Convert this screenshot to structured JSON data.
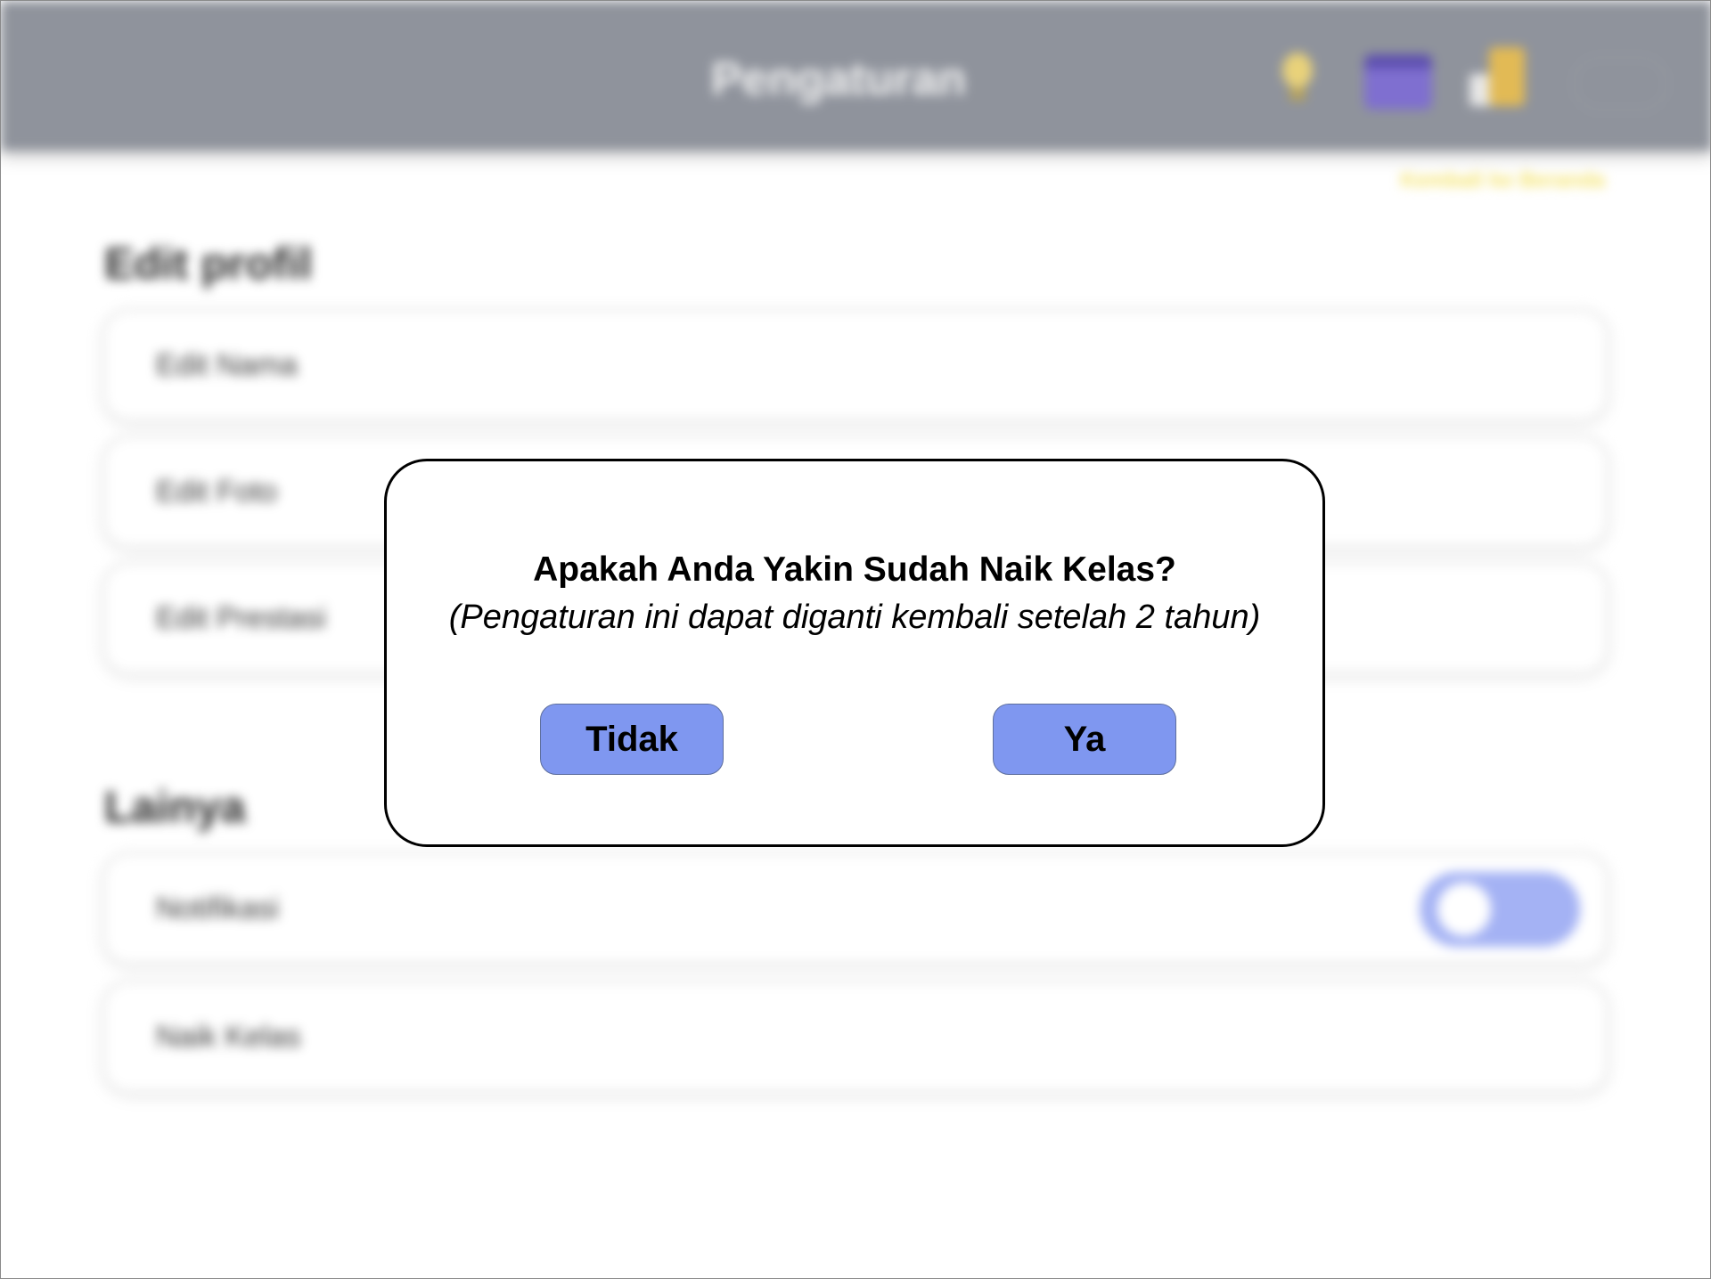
{
  "header": {
    "title": "Pengaturan",
    "icons": [
      "lightbulb-icon",
      "calendar-icon",
      "badge-icon",
      "cloud-icon"
    ]
  },
  "header_link": "Kembali ke Beranda",
  "profile_section": {
    "title": "Edit profil",
    "items": [
      {
        "label": "Edit Nama"
      },
      {
        "label": "Edit Foto"
      },
      {
        "label": "Edit Prestasi"
      }
    ]
  },
  "other_section": {
    "title": "Lainya",
    "items": [
      {
        "label": "Notifikasi",
        "toggle_on": true
      },
      {
        "label": "Naik Kelas"
      }
    ]
  },
  "dialog": {
    "title": "Apakah Anda Yakin Sudah Naik Kelas?",
    "subtitle": "(Pengaturan ini dapat diganti kembali setelah 2 tahun)",
    "no_label": "Tidak",
    "yes_label": "Ya"
  },
  "colors": {
    "header_bg": "#8f939c",
    "button_bg": "#7f97f0",
    "toggle_bg": "#a4b2f4",
    "link_color": "#f4e36a"
  }
}
